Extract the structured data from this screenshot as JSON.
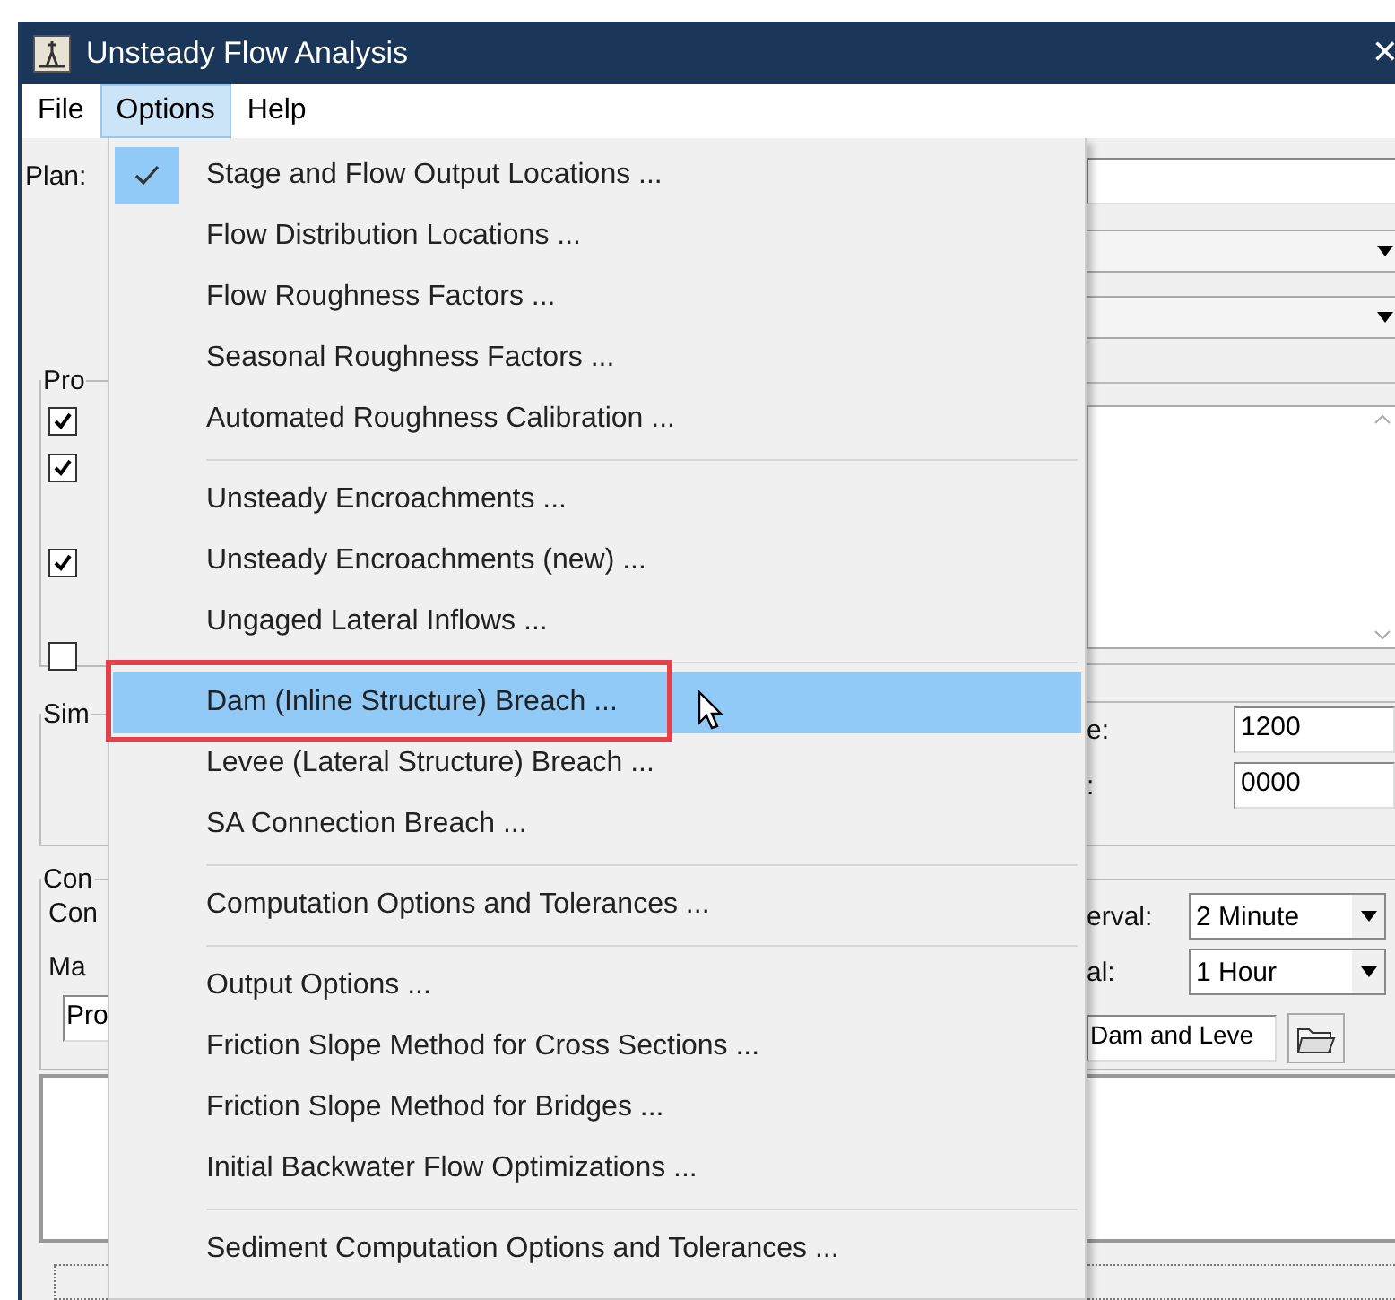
{
  "window": {
    "title": "Unsteady Flow Analysis",
    "close": "✕"
  },
  "menu_bar": [
    {
      "label": "File",
      "selected": false
    },
    {
      "label": "Options",
      "selected": true
    },
    {
      "label": "Help",
      "selected": false
    }
  ],
  "options_menu": {
    "groups": [
      [
        {
          "label": "Stage and Flow Output Locations ...",
          "checked": true,
          "highlighted": false,
          "annotated": false
        },
        {
          "label": "Flow Distribution Locations ...",
          "checked": false,
          "highlighted": false,
          "annotated": false
        },
        {
          "label": "Flow Roughness Factors ...",
          "checked": false,
          "highlighted": false,
          "annotated": false
        },
        {
          "label": "Seasonal Roughness Factors ...",
          "checked": false,
          "highlighted": false,
          "annotated": false
        },
        {
          "label": "Automated Roughness Calibration ...",
          "checked": false,
          "highlighted": false,
          "annotated": false
        }
      ],
      [
        {
          "label": "Unsteady Encroachments ...",
          "checked": false,
          "highlighted": false,
          "annotated": false
        },
        {
          "label": "Unsteady Encroachments (new) ...",
          "checked": false,
          "highlighted": false,
          "annotated": false
        },
        {
          "label": "Ungaged Lateral Inflows ...",
          "checked": false,
          "highlighted": false,
          "annotated": false
        }
      ],
      [
        {
          "label": "Dam (Inline Structure) Breach ...",
          "checked": false,
          "highlighted": true,
          "annotated": true
        },
        {
          "label": "Levee (Lateral Structure) Breach ...",
          "checked": false,
          "highlighted": false,
          "annotated": false
        },
        {
          "label": "SA Connection Breach ...",
          "checked": false,
          "highlighted": false,
          "annotated": false
        }
      ],
      [
        {
          "label": "Computation Options and Tolerances ...",
          "checked": false,
          "highlighted": false,
          "annotated": false
        }
      ],
      [
        {
          "label": "Output Options ...",
          "checked": false,
          "highlighted": false,
          "annotated": false
        },
        {
          "label": "Friction Slope Method for Cross Sections ...",
          "checked": false,
          "highlighted": false,
          "annotated": false
        },
        {
          "label": "Friction Slope Method for Bridges ...",
          "checked": false,
          "highlighted": false,
          "annotated": false
        },
        {
          "label": "Initial Backwater Flow Optimizations ...",
          "checked": false,
          "highlighted": false,
          "annotated": false
        }
      ],
      [
        {
          "label": "Sediment Computation Options and Tolerances ...",
          "checked": false,
          "highlighted": false,
          "annotated": false
        }
      ]
    ]
  },
  "left": {
    "plan_label": "Plan:",
    "group_1": "Pro",
    "checkboxes": [
      {
        "checked": true
      },
      {
        "checked": true
      },
      {
        "checked": true
      },
      {
        "checked": false
      }
    ],
    "group_2": "Sim",
    "group_3": "Con",
    "label_1": "Con",
    "label_2": "Ma",
    "field": "Pro"
  },
  "right": {
    "label_1": "e:",
    "field_1": "1200",
    "label_2": ":",
    "field_2": "0000",
    "label_3": "erval:",
    "dropdown_1": "2 Minute",
    "label_4": "al:",
    "dropdown_2": "1 Hour",
    "field_3": "Dam and Leve"
  }
}
